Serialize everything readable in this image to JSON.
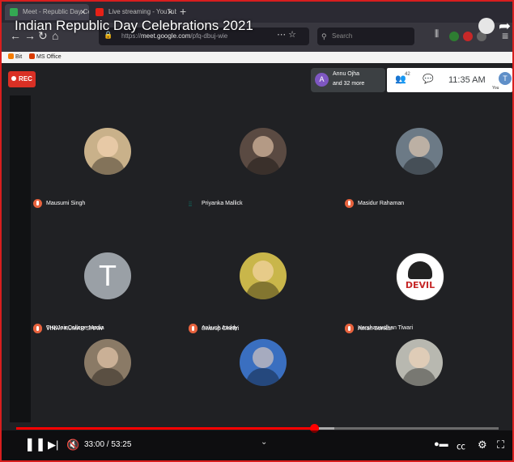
{
  "browser": {
    "tabs": [
      {
        "label": "Meet - Republic Day Celeb",
        "active": true
      },
      {
        "label": "Live streaming - YouTube St",
        "active": false
      }
    ],
    "url_prefix": "https://",
    "url_domain": "meet.google.com",
    "url_path": "/pfq-dbuj-wie",
    "search_placeholder": "Search",
    "bookmarks": [
      "Bit",
      "MS Office"
    ]
  },
  "video_title": "Indian Republic Day Celebrations 2021",
  "meet": {
    "rec_label": "REC",
    "presenter_initial": "A",
    "presenter_name": "Annu Ojha",
    "presenter_more": "and 32 more",
    "people_count": "42",
    "time": "11:35 AM",
    "self_initial": "T",
    "self_label": "You"
  },
  "participants": [
    {
      "name": "Mausumi Singh",
      "status": "muted",
      "avatar": "photo",
      "bg": "#c9b18a"
    },
    {
      "name": "Priyanka Mallick",
      "status": "speaking",
      "avatar": "photo",
      "bg": "#5a4a42"
    },
    {
      "name": "Masidur Rahaman",
      "status": "muted",
      "avatar": "photo",
      "bg": "#6c7a86"
    },
    {
      "name": "THKJainCollege Media",
      "status": "muted",
      "avatar": "letter",
      "initial": "T",
      "bg": "#9aa0a6"
    },
    {
      "name": "Ankush Auddy",
      "status": "muted",
      "avatar": "photo",
      "bg": "#c9b64a"
    },
    {
      "name": "Harshavardhan Tiwari",
      "status": "muted",
      "avatar": "logo",
      "bg": "#ffffff",
      "logo_text": "DEVIL"
    },
    {
      "name": "VINAY KUMAR SHAW",
      "status": "muted",
      "avatar": "photo",
      "bg": "#8a7a66"
    },
    {
      "name": "Swarup Chettri",
      "status": "muted",
      "avatar": "photo",
      "bg": "#3a6fc0"
    },
    {
      "name": "Aman Sonkar",
      "status": "muted",
      "avatar": "photo",
      "bg": "#b8b8b0"
    }
  ],
  "player": {
    "current_time": "33:00",
    "duration": "53:25",
    "progress": 0.6178,
    "buffered": 0.66
  },
  "colors": {
    "accent_red": "#ff0000",
    "mic_muted": "#e8633e",
    "speaking": "#00c2a8",
    "rec": "#d93025"
  }
}
